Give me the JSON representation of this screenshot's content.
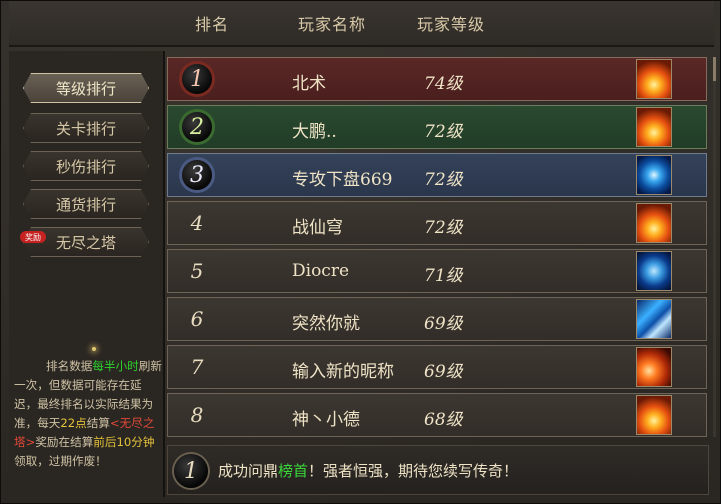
{
  "header": {
    "col_rank": "排名",
    "col_name": "玩家名称",
    "col_level": "玩家等级"
  },
  "sidebar": {
    "items": [
      {
        "label": "等级排行",
        "active": true
      },
      {
        "label": "关卡排行",
        "active": false
      },
      {
        "label": "秒伤排行",
        "active": false
      },
      {
        "label": "通货排行",
        "active": false
      },
      {
        "label": "无尽之塔",
        "active": false
      }
    ],
    "badge": "奖励",
    "notice": {
      "p1": "排名数据",
      "g1": "每半小时",
      "p2": "刷新一次，但数据可能存在延迟，最终排名以实际结果为准，每天",
      "g2": "22点",
      "p3": "结算",
      "r1": "<无尽之塔>",
      "p4": "奖励在结算",
      "g3": "前后10分钟",
      "p5": "领取，过期作废！"
    }
  },
  "rows": [
    {
      "rank": "1",
      "name": "北术",
      "level": "74级",
      "icon": "fire-icon"
    },
    {
      "rank": "2",
      "name": "大鹏..",
      "level": "72级",
      "icon": "fire-icon"
    },
    {
      "rank": "3",
      "name": "专攻下盘669",
      "level": "72级",
      "icon": "swirl-icon"
    },
    {
      "rank": "4",
      "name": "战仙穹",
      "level": "72级",
      "icon": "fire-icon"
    },
    {
      "rank": "5",
      "name": "Diocre",
      "level": "71级",
      "icon": "snowflake-icon"
    },
    {
      "rank": "6",
      "name": "突然你就",
      "level": "69级",
      "icon": "ice-icon"
    },
    {
      "rank": "7",
      "name": "输入新的昵称",
      "level": "69级",
      "icon": "fireball-icon"
    },
    {
      "rank": "8",
      "name": "神丶小德",
      "level": "68级",
      "icon": "fire-icon"
    }
  ],
  "footer": {
    "rank": "1",
    "msg_a": "成功问鼎",
    "msg_g": "榜首",
    "msg_b": "！强者恒强，期待您续写传奇！"
  }
}
